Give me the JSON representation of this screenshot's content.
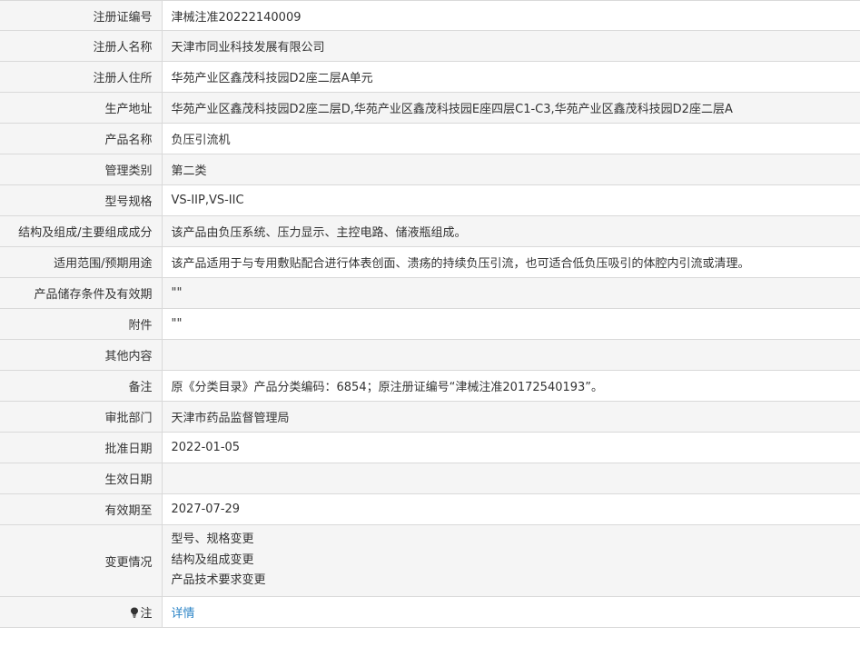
{
  "fields": [
    {
      "label": "注册证编号",
      "value": "津械注准20222140009"
    },
    {
      "label": "注册人名称",
      "value": "天津市同业科技发展有限公司"
    },
    {
      "label": "注册人住所",
      "value": "华苑产业区鑫茂科技园D2座二层A单元"
    },
    {
      "label": "生产地址",
      "value": "华苑产业区鑫茂科技园D2座二层D,华苑产业区鑫茂科技园E座四层C1-C3,华苑产业区鑫茂科技园D2座二层A"
    },
    {
      "label": "产品名称",
      "value": "负压引流机"
    },
    {
      "label": "管理类别",
      "value": "第二类"
    },
    {
      "label": "型号规格",
      "value": "VS-IIP,VS-IIC"
    },
    {
      "label": "结构及组成/主要组成成分",
      "value": "该产品由负压系统、压力显示、主控电路、储液瓶组成。"
    },
    {
      "label": "适用范围/预期用途",
      "value": "该产品适用于与专用敷贴配合进行体表创面、溃疡的持续负压引流，也可适合低负压吸引的体腔内引流或清理。"
    },
    {
      "label": "产品储存条件及有效期",
      "value": "\"\""
    },
    {
      "label": "附件",
      "value": "\"\""
    },
    {
      "label": "其他内容",
      "value": ""
    },
    {
      "label": "备注",
      "value": "原《分类目录》产品分类编码：6854；原注册证编号“津械注准20172540193”。"
    },
    {
      "label": "审批部门",
      "value": "天津市药品监督管理局"
    },
    {
      "label": "批准日期",
      "value": "2022-01-05"
    },
    {
      "label": "生效日期",
      "value": ""
    },
    {
      "label": "有效期至",
      "value": "2027-07-29"
    }
  ],
  "changes": {
    "label": "变更情况",
    "items": [
      "型号、规格变更",
      "结构及组成变更",
      "产品技术要求变更"
    ]
  },
  "note": {
    "icon": "lightbulb-icon",
    "label": "注",
    "link_text": "详情",
    "link_color": "#2b84c6"
  }
}
